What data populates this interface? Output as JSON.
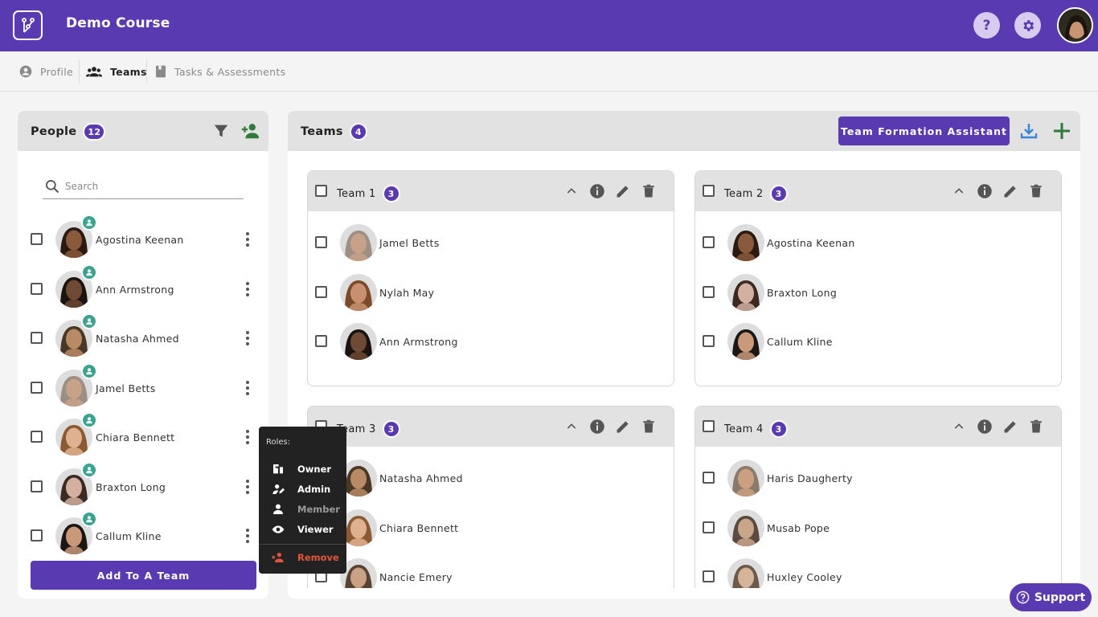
{
  "app": {
    "title": "Demo Course",
    "help_label": "?"
  },
  "tabs": [
    {
      "label": "Profile",
      "active": false
    },
    {
      "label": "Teams",
      "active": true
    },
    {
      "label": "Tasks & Assessments",
      "active": false
    }
  ],
  "people": {
    "title": "People",
    "count": "12",
    "search_placeholder": "Search",
    "add_button": "Add To A Team",
    "rows": [
      {
        "name": "Agostina Keenan",
        "skin": "#8a5a3c",
        "hair": "#2a1a12"
      },
      {
        "name": "Ann Armstrong",
        "skin": "#6f4a34",
        "hair": "#1a1310"
      },
      {
        "name": "Natasha Ahmed",
        "skin": "#b88a66",
        "hair": "#4a3826"
      },
      {
        "name": "Jamel Betts",
        "skin": "#c7a188",
        "hair": "#9c8f84"
      },
      {
        "name": "Chiara Bennett",
        "skin": "#e0b190",
        "hair": "#8b5a33"
      },
      {
        "name": "Braxton Long",
        "skin": "#d4b0a0",
        "hair": "#3b2a22"
      },
      {
        "name": "Callum Kline",
        "skin": "#c99a7a",
        "hair": "#1c1614"
      }
    ]
  },
  "teams_panel": {
    "title": "Teams",
    "count": "4",
    "formation_button": "Team Formation Assistant"
  },
  "teams": [
    {
      "name": "Team 1",
      "count": "3",
      "members": [
        {
          "name": "Jamel Betts",
          "skin": "#c7a188",
          "hair": "#9c8f84"
        },
        {
          "name": "Nylah May",
          "skin": "#c99070",
          "hair": "#7a4a2a"
        },
        {
          "name": "Ann Armstrong",
          "skin": "#6f4a34",
          "hair": "#1a1310"
        }
      ]
    },
    {
      "name": "Team 2",
      "count": "3",
      "members": [
        {
          "name": "Agostina Keenan",
          "skin": "#8a5a3c",
          "hair": "#2a1a12"
        },
        {
          "name": "Braxton Long",
          "skin": "#d4b0a0",
          "hair": "#3b2a22"
        },
        {
          "name": "Callum Kline",
          "skin": "#c99a7a",
          "hair": "#1c1614"
        }
      ]
    },
    {
      "name": "Team 3",
      "count": "3",
      "members": [
        {
          "name": "Natasha Ahmed",
          "skin": "#b88a66",
          "hair": "#4a3826"
        },
        {
          "name": "Chiara Bennett",
          "skin": "#e0b190",
          "hair": "#8b5a33"
        },
        {
          "name": "Nancie Emery",
          "skin": "#c9a285",
          "hair": "#5a4232"
        }
      ]
    },
    {
      "name": "Team 4",
      "count": "3",
      "members": [
        {
          "name": "Haris Daugherty",
          "skin": "#caa080",
          "hair": "#8a7a6a"
        },
        {
          "name": "Musab Pope",
          "skin": "#c9a58a",
          "hair": "#5a4a40"
        },
        {
          "name": "Huxley Cooley",
          "skin": "#d6b49a",
          "hair": "#6b5a4a"
        }
      ]
    }
  ],
  "roles_menu": {
    "label": "Roles:",
    "items": [
      {
        "label": "Owner",
        "icon": "owner-icon",
        "color": "#ffffff"
      },
      {
        "label": "Admin",
        "icon": "admin-icon",
        "color": "#ffffff"
      },
      {
        "label": "Member",
        "icon": "member-icon",
        "color": "#9a9a9a"
      },
      {
        "label": "Viewer",
        "icon": "viewer-icon",
        "color": "#ffffff"
      }
    ],
    "remove_label": "Remove",
    "remove_color": "#e0553c"
  },
  "support": {
    "label": "Support"
  },
  "colors": {
    "brand": "#5a3ab0",
    "role_badge": "#3aa48f",
    "add_person": "#2f7a3a",
    "download": "#3a86d4",
    "add_team": "#2f7a3a"
  }
}
